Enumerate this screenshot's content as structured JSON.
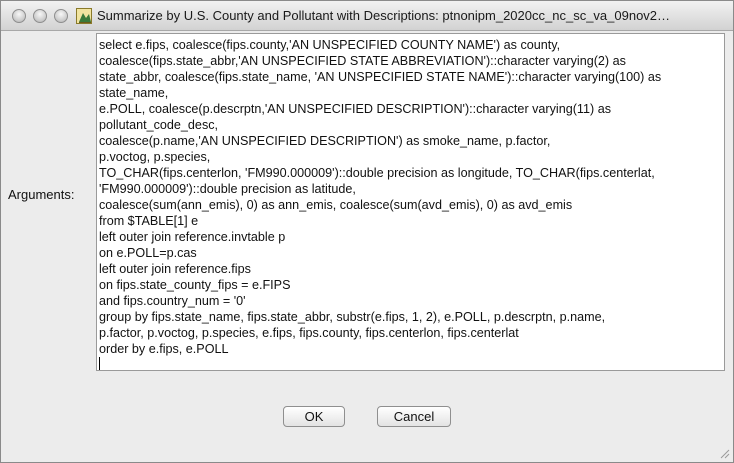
{
  "window": {
    "title": "Summarize by U.S. County and Pollutant with Descriptions: ptnonipm_2020cc_nc_sc_va_09nov2…"
  },
  "form": {
    "arguments_label": "Arguments:",
    "arguments_lines": [
      "select e.fips, coalesce(fips.county,'AN UNSPECIFIED COUNTY NAME') as county,",
      "coalesce(fips.state_abbr,'AN UNSPECIFIED STATE ABBREVIATION')::character varying(2) as",
      "state_abbr, coalesce(fips.state_name, 'AN UNSPECIFIED STATE NAME')::character varying(100) as",
      "state_name,",
      "e.POLL, coalesce(p.descrptn,'AN UNSPECIFIED DESCRIPTION')::character varying(11) as",
      "pollutant_code_desc,",
      "coalesce(p.name,'AN UNSPECIFIED DESCRIPTION') as smoke_name, p.factor,",
      "p.voctog, p.species,",
      "TO_CHAR(fips.centerlon, 'FM990.000009')::double precision as longitude, TO_CHAR(fips.centerlat,",
      "'FM990.000009')::double precision as latitude,",
      "coalesce(sum(ann_emis), 0) as ann_emis, coalesce(sum(avd_emis), 0) as avd_emis",
      "from $TABLE[1] e",
      "left outer join reference.invtable p",
      "on e.POLL=p.cas",
      "left outer join reference.fips",
      "on fips.state_county_fips = e.FIPS",
      "and fips.country_num = '0'",
      "group by fips.state_name, fips.state_abbr, substr(e.fips, 1, 2), e.POLL, p.descrptn, p.name,",
      "p.factor, p.voctog, p.species, e.fips, fips.county, fips.centerlon, fips.centerlat",
      "order by e.fips, e.POLL"
    ]
  },
  "buttons": {
    "ok_label": "OK",
    "cancel_label": "Cancel"
  }
}
